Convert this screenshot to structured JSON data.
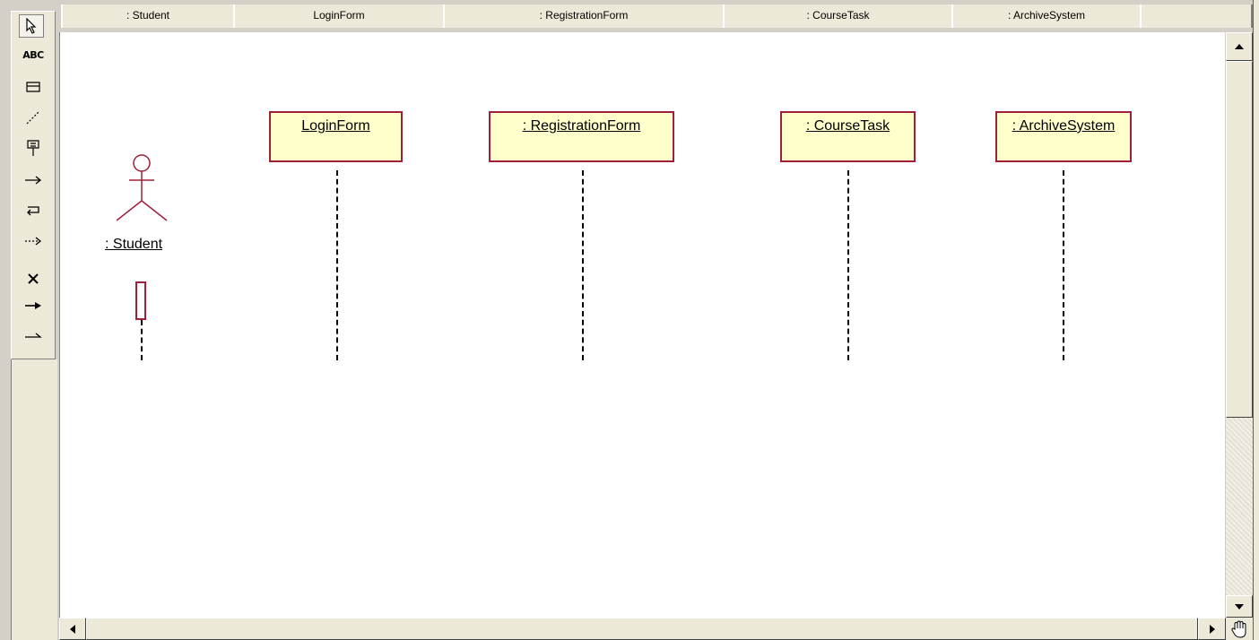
{
  "header": {
    "columns": [
      ": Student",
      "LoginForm",
      ": RegistrationForm",
      ": CourseTask",
      ": ArchiveSystem"
    ]
  },
  "palette": {
    "tools": [
      "pointer-icon",
      "text-tool-icon",
      "note-icon",
      "anchor-line-icon",
      "object-icon",
      "message-arrow-icon",
      "return-message-icon",
      "dashed-message-icon",
      "destruction-x-icon",
      "solid-arrow-icon",
      "half-arrow-icon"
    ],
    "text_tool_label": "ABC"
  },
  "diagram": {
    "actor": {
      "name": ": Student"
    },
    "objects": [
      {
        "label": "LoginForm"
      },
      {
        "label": ": RegistrationForm"
      },
      {
        "label": ": CourseTask"
      },
      {
        "label": ": ArchiveSystem"
      }
    ]
  },
  "colors": {
    "object_fill": "#ffffcc",
    "object_border": "#a0203c",
    "actor_stroke": "#a0203c"
  }
}
